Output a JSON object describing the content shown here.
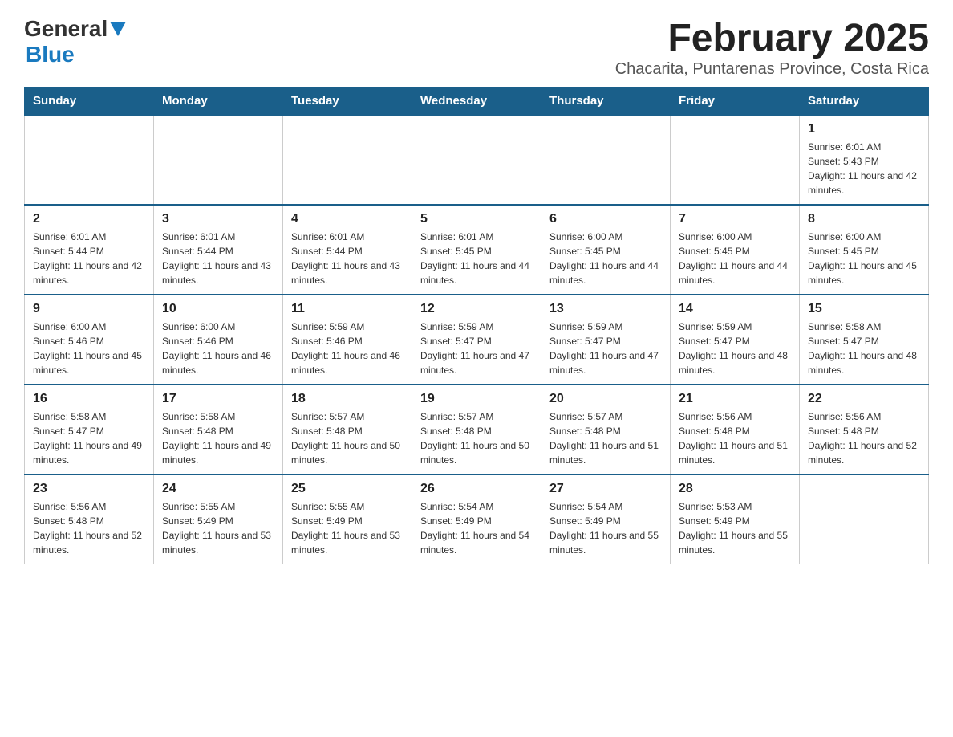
{
  "header": {
    "logo_general": "General",
    "logo_blue": "Blue",
    "month_title": "February 2025",
    "location": "Chacarita, Puntarenas Province, Costa Rica"
  },
  "weekdays": [
    "Sunday",
    "Monday",
    "Tuesday",
    "Wednesday",
    "Thursday",
    "Friday",
    "Saturday"
  ],
  "weeks": [
    [
      {
        "day": "",
        "sunrise": "",
        "sunset": "",
        "daylight": ""
      },
      {
        "day": "",
        "sunrise": "",
        "sunset": "",
        "daylight": ""
      },
      {
        "day": "",
        "sunrise": "",
        "sunset": "",
        "daylight": ""
      },
      {
        "day": "",
        "sunrise": "",
        "sunset": "",
        "daylight": ""
      },
      {
        "day": "",
        "sunrise": "",
        "sunset": "",
        "daylight": ""
      },
      {
        "day": "",
        "sunrise": "",
        "sunset": "",
        "daylight": ""
      },
      {
        "day": "1",
        "sunrise": "Sunrise: 6:01 AM",
        "sunset": "Sunset: 5:43 PM",
        "daylight": "Daylight: 11 hours and 42 minutes."
      }
    ],
    [
      {
        "day": "2",
        "sunrise": "Sunrise: 6:01 AM",
        "sunset": "Sunset: 5:44 PM",
        "daylight": "Daylight: 11 hours and 42 minutes."
      },
      {
        "day": "3",
        "sunrise": "Sunrise: 6:01 AM",
        "sunset": "Sunset: 5:44 PM",
        "daylight": "Daylight: 11 hours and 43 minutes."
      },
      {
        "day": "4",
        "sunrise": "Sunrise: 6:01 AM",
        "sunset": "Sunset: 5:44 PM",
        "daylight": "Daylight: 11 hours and 43 minutes."
      },
      {
        "day": "5",
        "sunrise": "Sunrise: 6:01 AM",
        "sunset": "Sunset: 5:45 PM",
        "daylight": "Daylight: 11 hours and 44 minutes."
      },
      {
        "day": "6",
        "sunrise": "Sunrise: 6:00 AM",
        "sunset": "Sunset: 5:45 PM",
        "daylight": "Daylight: 11 hours and 44 minutes."
      },
      {
        "day": "7",
        "sunrise": "Sunrise: 6:00 AM",
        "sunset": "Sunset: 5:45 PM",
        "daylight": "Daylight: 11 hours and 44 minutes."
      },
      {
        "day": "8",
        "sunrise": "Sunrise: 6:00 AM",
        "sunset": "Sunset: 5:45 PM",
        "daylight": "Daylight: 11 hours and 45 minutes."
      }
    ],
    [
      {
        "day": "9",
        "sunrise": "Sunrise: 6:00 AM",
        "sunset": "Sunset: 5:46 PM",
        "daylight": "Daylight: 11 hours and 45 minutes."
      },
      {
        "day": "10",
        "sunrise": "Sunrise: 6:00 AM",
        "sunset": "Sunset: 5:46 PM",
        "daylight": "Daylight: 11 hours and 46 minutes."
      },
      {
        "day": "11",
        "sunrise": "Sunrise: 5:59 AM",
        "sunset": "Sunset: 5:46 PM",
        "daylight": "Daylight: 11 hours and 46 minutes."
      },
      {
        "day": "12",
        "sunrise": "Sunrise: 5:59 AM",
        "sunset": "Sunset: 5:47 PM",
        "daylight": "Daylight: 11 hours and 47 minutes."
      },
      {
        "day": "13",
        "sunrise": "Sunrise: 5:59 AM",
        "sunset": "Sunset: 5:47 PM",
        "daylight": "Daylight: 11 hours and 47 minutes."
      },
      {
        "day": "14",
        "sunrise": "Sunrise: 5:59 AM",
        "sunset": "Sunset: 5:47 PM",
        "daylight": "Daylight: 11 hours and 48 minutes."
      },
      {
        "day": "15",
        "sunrise": "Sunrise: 5:58 AM",
        "sunset": "Sunset: 5:47 PM",
        "daylight": "Daylight: 11 hours and 48 minutes."
      }
    ],
    [
      {
        "day": "16",
        "sunrise": "Sunrise: 5:58 AM",
        "sunset": "Sunset: 5:47 PM",
        "daylight": "Daylight: 11 hours and 49 minutes."
      },
      {
        "day": "17",
        "sunrise": "Sunrise: 5:58 AM",
        "sunset": "Sunset: 5:48 PM",
        "daylight": "Daylight: 11 hours and 49 minutes."
      },
      {
        "day": "18",
        "sunrise": "Sunrise: 5:57 AM",
        "sunset": "Sunset: 5:48 PM",
        "daylight": "Daylight: 11 hours and 50 minutes."
      },
      {
        "day": "19",
        "sunrise": "Sunrise: 5:57 AM",
        "sunset": "Sunset: 5:48 PM",
        "daylight": "Daylight: 11 hours and 50 minutes."
      },
      {
        "day": "20",
        "sunrise": "Sunrise: 5:57 AM",
        "sunset": "Sunset: 5:48 PM",
        "daylight": "Daylight: 11 hours and 51 minutes."
      },
      {
        "day": "21",
        "sunrise": "Sunrise: 5:56 AM",
        "sunset": "Sunset: 5:48 PM",
        "daylight": "Daylight: 11 hours and 51 minutes."
      },
      {
        "day": "22",
        "sunrise": "Sunrise: 5:56 AM",
        "sunset": "Sunset: 5:48 PM",
        "daylight": "Daylight: 11 hours and 52 minutes."
      }
    ],
    [
      {
        "day": "23",
        "sunrise": "Sunrise: 5:56 AM",
        "sunset": "Sunset: 5:48 PM",
        "daylight": "Daylight: 11 hours and 52 minutes."
      },
      {
        "day": "24",
        "sunrise": "Sunrise: 5:55 AM",
        "sunset": "Sunset: 5:49 PM",
        "daylight": "Daylight: 11 hours and 53 minutes."
      },
      {
        "day": "25",
        "sunrise": "Sunrise: 5:55 AM",
        "sunset": "Sunset: 5:49 PM",
        "daylight": "Daylight: 11 hours and 53 minutes."
      },
      {
        "day": "26",
        "sunrise": "Sunrise: 5:54 AM",
        "sunset": "Sunset: 5:49 PM",
        "daylight": "Daylight: 11 hours and 54 minutes."
      },
      {
        "day": "27",
        "sunrise": "Sunrise: 5:54 AM",
        "sunset": "Sunset: 5:49 PM",
        "daylight": "Daylight: 11 hours and 55 minutes."
      },
      {
        "day": "28",
        "sunrise": "Sunrise: 5:53 AM",
        "sunset": "Sunset: 5:49 PM",
        "daylight": "Daylight: 11 hours and 55 minutes."
      },
      {
        "day": "",
        "sunrise": "",
        "sunset": "",
        "daylight": ""
      }
    ]
  ]
}
